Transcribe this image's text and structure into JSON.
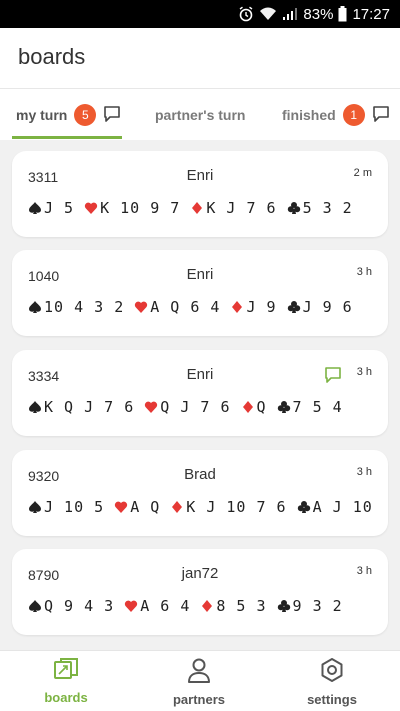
{
  "status_bar": {
    "battery": "83%",
    "time": "17:27"
  },
  "header": {
    "title": "boards"
  },
  "tabs": [
    {
      "label": "my turn",
      "badge": "5"
    },
    {
      "label": "partner's turn"
    },
    {
      "label": "finished",
      "badge": "1"
    }
  ],
  "boards": [
    {
      "number": "3311",
      "player": "Enri",
      "time": "2 m",
      "has_chat": false,
      "hand": {
        "spades": "J 5",
        "hearts": "K 10 9 7",
        "diamonds": "K J 7 6",
        "clubs": "5 3 2"
      }
    },
    {
      "number": "1040",
      "player": "Enri",
      "time": "3 h",
      "has_chat": false,
      "hand": {
        "spades": "10 4 3 2",
        "hearts": "A Q 6 4",
        "diamonds": "J 9",
        "clubs": "J 9 6"
      }
    },
    {
      "number": "3334",
      "player": "Enri",
      "time": "3 h",
      "has_chat": true,
      "hand": {
        "spades": "K Q J 7 6",
        "hearts": "Q J 7 6",
        "diamonds": "Q",
        "clubs": "7 5 4"
      }
    },
    {
      "number": "9320",
      "player": "Brad",
      "time": "3 h",
      "has_chat": false,
      "hand": {
        "spades": "J 10 5",
        "hearts": "A Q",
        "diamonds": "K J 10 7 6",
        "clubs": "A J 10"
      }
    },
    {
      "number": "8790",
      "player": "jan72",
      "time": "3 h",
      "has_chat": false,
      "hand": {
        "spades": "Q 9 4 3",
        "hearts": "A 6 4",
        "diamonds": "8 5 3",
        "clubs": "9 3 2"
      }
    }
  ],
  "bottom_nav": [
    {
      "label": "boards",
      "icon": "boards-icon",
      "active": true
    },
    {
      "label": "partners",
      "icon": "partners-icon",
      "active": false
    },
    {
      "label": "settings",
      "icon": "settings-icon",
      "active": false
    }
  ],
  "colors": {
    "accent": "#7cb342",
    "badge": "#ee5a2f",
    "hearts": "#e53935",
    "black": "#222222"
  }
}
